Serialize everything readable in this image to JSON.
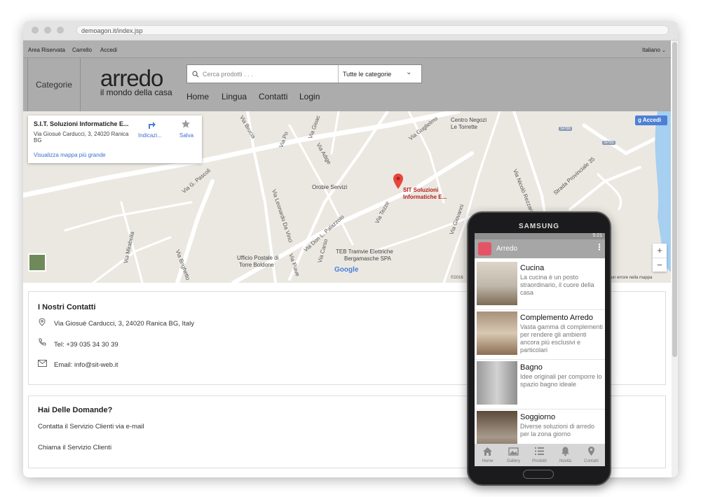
{
  "browser": {
    "url": "demoagon.it/index.jsp"
  },
  "topbar": {
    "links": [
      "Area Riservata",
      "Carrello",
      "Accedi"
    ],
    "language": "Italiano"
  },
  "header": {
    "categories_label": "Categorie",
    "logo": "arredo",
    "logo_tagline": "il mondo della casa",
    "search_placeholder": "Cerca prodotti . . .",
    "category_select": "Tutte le categorie",
    "nav": [
      "Home",
      "Lingua",
      "Contatti",
      "Login"
    ]
  },
  "map": {
    "card": {
      "title": "S.I.T. Soluzioni Informatiche E...",
      "address_line1": "Via Giosuè Carducci, 3, 24020 Ranica",
      "address_line2": "BG",
      "directions": "Indicazi...",
      "save": "Salva",
      "larger_map": "Visualizza mappa più grande"
    },
    "signin": "Accedi",
    "pin_label_line1": "SIT Soluzioni",
    "pin_label_line2": "Informatiche E...",
    "streets": [
      "Via Brucia",
      "Via Gioac",
      "Via Po",
      "Via Adige",
      "Via Guglielmo",
      "Centro Negozi",
      "Le Torrette",
      "Via G. Pascoli",
      "Orobie Servizi",
      "Via Leonardo Da Vinci",
      "Via Don L. Palazzolo",
      "Via Tezze",
      "Via Mirabella",
      "Ufficio Postale di",
      "Torre Boldone",
      "TEB Tramvie Elettriche",
      "Bergamasche SPA",
      "Strada Provinciale 35",
      "Via Nicolò Rezzara",
      "Via Giovanni",
      "SP38",
      "SP35",
      "Via Brighetto",
      "Via Piave",
      "Via Carso"
    ],
    "copyright": "©2016",
    "report": "Segnala un errore nella mappa",
    "google": "Google",
    "zoom_in": "+",
    "zoom_out": "−"
  },
  "contacts": {
    "title": "I Nostri Contatti",
    "address": "Via Giosuè Carducci, 3, 24020 Ranica BG, Italy",
    "phone": "Tel: +39 035 34 30 39",
    "email": "Email: info@sit-web.it"
  },
  "questions": {
    "title": "Hai Delle Domande?",
    "email_link": "Contatta il Servizio Clienti via e-mail",
    "phone_link": "Chiama il Servizio Clienti"
  },
  "phone": {
    "brand": "SAMSUNG",
    "time": "5:21",
    "app_title": "Arredo",
    "items": [
      {
        "title": "Cucina",
        "desc": "La cucina è un posto straordinario, il cuore della casa"
      },
      {
        "title": "Complemento Arredo",
        "desc": "Vasta gamma di complementi per rendere gli ambienti ancora più esclusivi e particolari"
      },
      {
        "title": "Bagno",
        "desc": "Idee originali per comporre lo spazio bagno ideale"
      },
      {
        "title": "Soggiorno",
        "desc": "Diverse soluzioni di arredo per la zona giorno"
      }
    ],
    "bottom_nav": [
      "Home",
      "Gallery",
      "Prodotti",
      "Novità",
      "Contatti"
    ]
  }
}
